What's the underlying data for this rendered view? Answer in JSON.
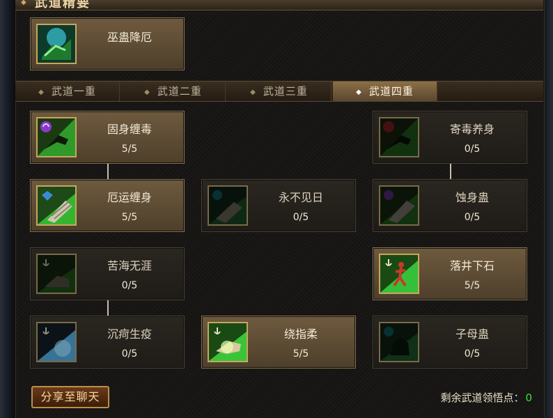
{
  "header": {
    "title": "武道精要"
  },
  "top_skill": {
    "name": "巫蛊降厄"
  },
  "tabs": [
    {
      "label": "武道一重",
      "active": false
    },
    {
      "label": "武道二重",
      "active": false
    },
    {
      "label": "武道三重",
      "active": false
    },
    {
      "label": "武道四重",
      "active": true
    }
  ],
  "skills": [
    {
      "name": "固身缠毒",
      "count": "5/5",
      "active": true,
      "icon": "poison-claw-icon"
    },
    {
      "name": "寄毒养身",
      "count": "0/5",
      "active": false,
      "icon": "poison-claw-icon"
    },
    {
      "name": "厄运缠身",
      "count": "5/5",
      "active": true,
      "icon": "bandaged-arm-icon"
    },
    {
      "name": "永不见日",
      "count": "0/5",
      "active": false,
      "icon": "bandaged-arm-icon"
    },
    {
      "name": "蚀身蛊",
      "count": "0/5",
      "active": false,
      "icon": "bandaged-arm-icon"
    },
    {
      "name": "苦海无涯",
      "count": "0/5",
      "active": false,
      "icon": "boot-icon"
    },
    {
      "name": "落井下石",
      "count": "5/5",
      "active": true,
      "icon": "running-figure-icon"
    },
    {
      "name": "沉疴生疫",
      "count": "0/5",
      "active": false,
      "icon": "blue-aura-icon"
    },
    {
      "name": "绕指柔",
      "count": "5/5",
      "active": true,
      "icon": "glowing-hand-icon"
    },
    {
      "name": "子母蛊",
      "count": "0/5",
      "active": false,
      "icon": "beast-icon"
    }
  ],
  "footer": {
    "share_label": "分享至聊天",
    "points_label": "剩余武道领悟点：",
    "points_value": "0"
  },
  "colors": {
    "points_value": "#3ee03e",
    "active_card": "#6e5a3e",
    "tab_active": "#8b6f47"
  }
}
